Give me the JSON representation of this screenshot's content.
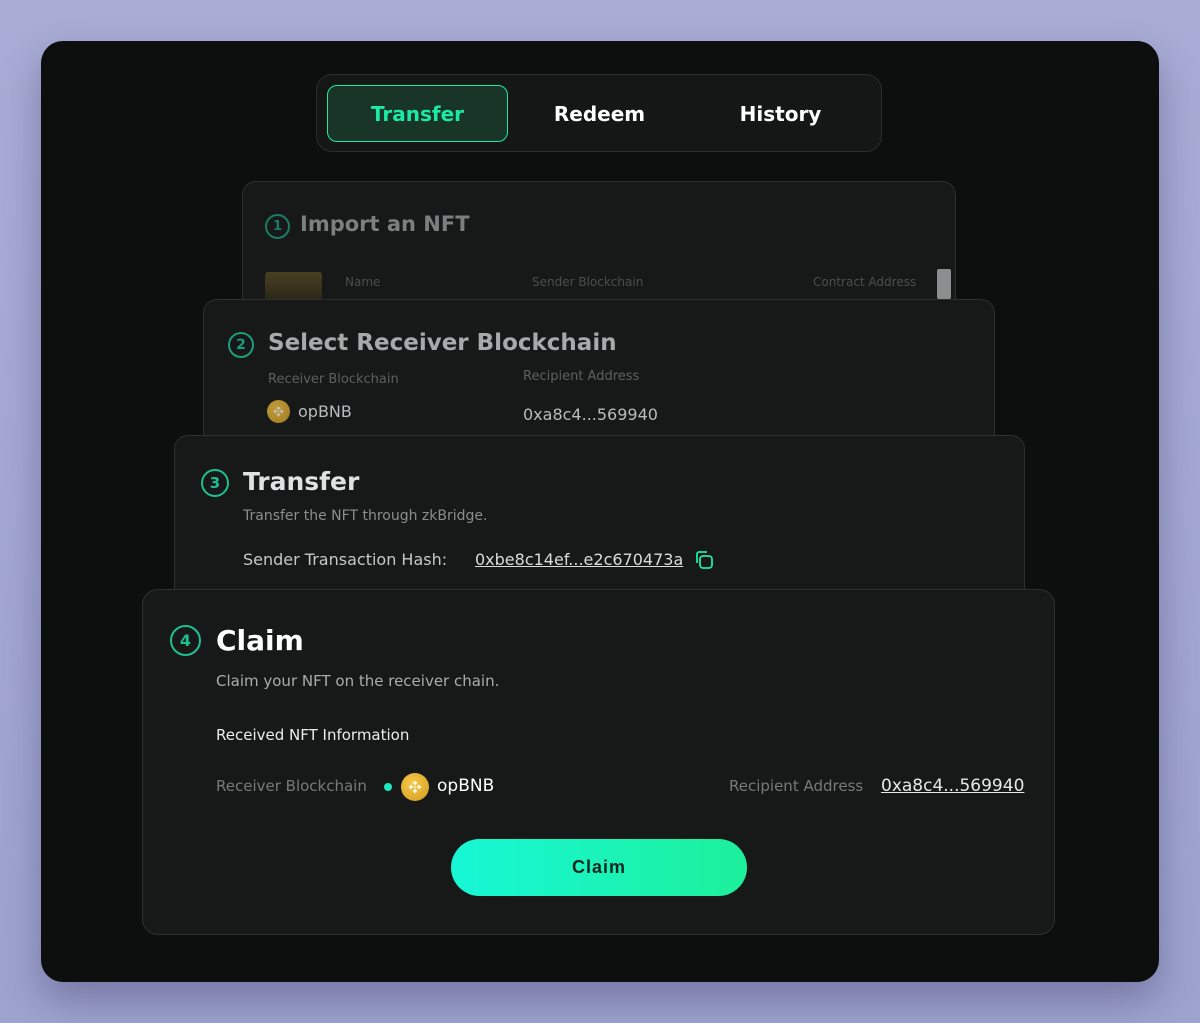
{
  "tabs": [
    {
      "label": "Transfer",
      "active": true
    },
    {
      "label": "Redeem",
      "active": false
    },
    {
      "label": "History",
      "active": false
    }
  ],
  "step1": {
    "number": "1",
    "title": "Import an NFT",
    "columns": [
      "Name",
      "Sender Blockchain",
      "Contract Address"
    ]
  },
  "step2": {
    "number": "2",
    "title": "Select Receiver Blockchain",
    "receiver_label": "Receiver Blockchain",
    "receiver_value": "opBNB",
    "recipient_label": "Recipient Address",
    "recipient_value": "0xa8c4...569940"
  },
  "step3": {
    "number": "3",
    "title": "Transfer",
    "description": "Transfer the NFT through zkBridge.",
    "hash_label": "Sender Transaction Hash:",
    "hash_value": "0xbe8c14ef...e2c670473a"
  },
  "step4": {
    "number": "4",
    "title": "Claim",
    "description": "Claim your NFT on the receiver chain.",
    "section_title": "Received NFT Information",
    "receiver_label": "Receiver Blockchain",
    "receiver_value": "opBNB",
    "recipient_label": "Recipient Address",
    "recipient_value": "0xa8c4...569940",
    "button_label": "Claim"
  },
  "colors": {
    "accent": "#1de9a6",
    "background": "#0d0e0e",
    "card": "#171919",
    "page": "#a9add6"
  },
  "icons": [
    "copy-icon",
    "bnb-chain-icon",
    "status-dot"
  ]
}
